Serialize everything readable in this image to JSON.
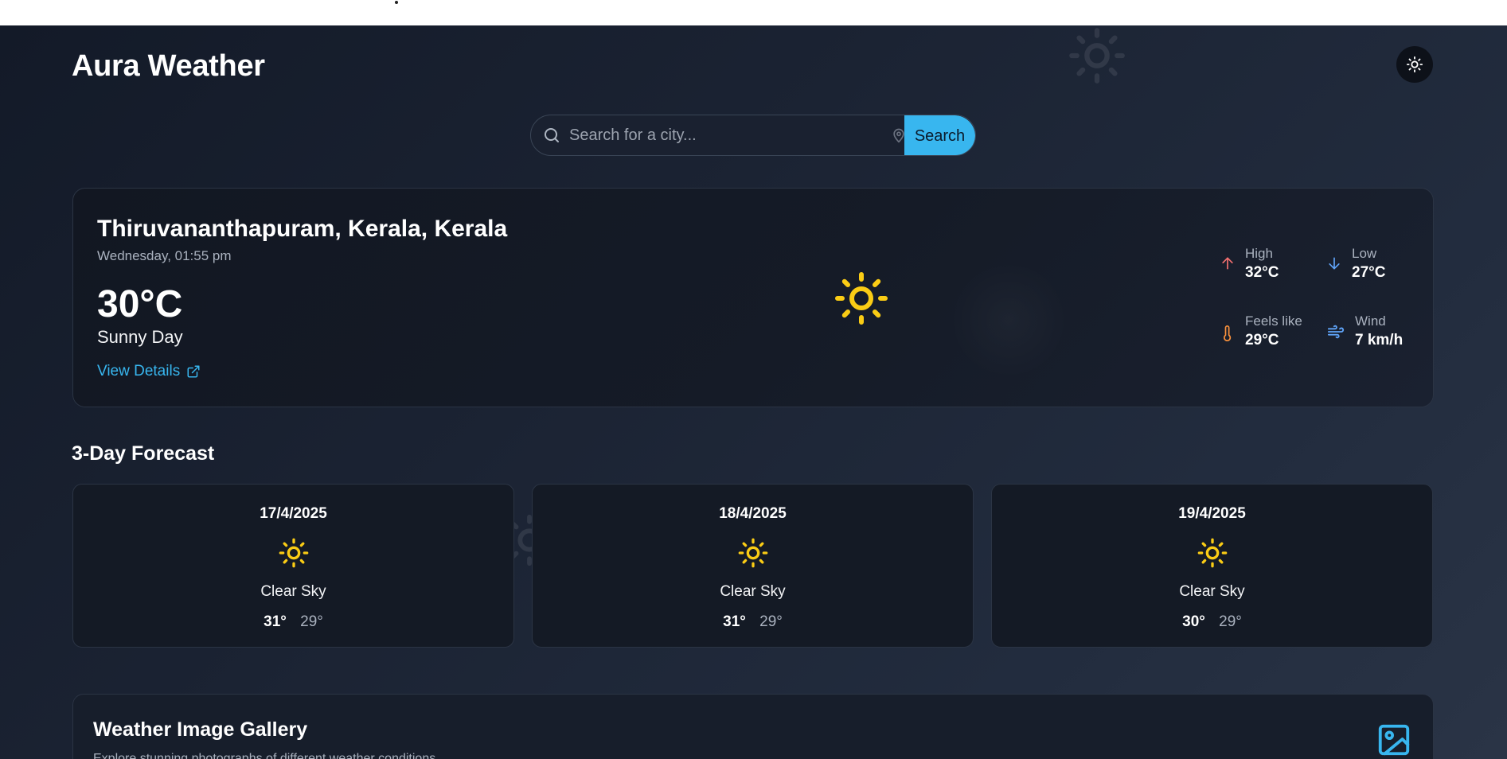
{
  "app": {
    "title": "Aura Weather"
  },
  "theme_toggle": {
    "icon": "sun-icon"
  },
  "search": {
    "placeholder": "Search for a city...",
    "button_label": "Search"
  },
  "current": {
    "location": "Thiruvananthapuram, Kerala, Kerala",
    "datetime": "Wednesday, 01:55 pm",
    "temperature": "30°C",
    "condition": "Sunny Day",
    "details_link": "View Details",
    "stats": {
      "high": {
        "label": "High",
        "value": "32°C",
        "color": "#f87171"
      },
      "low": {
        "label": "Low",
        "value": "27°C",
        "color": "#60a5fa"
      },
      "feels_like": {
        "label": "Feels like",
        "value": "29°C",
        "color": "#fb923c"
      },
      "wind": {
        "label": "Wind",
        "value": "7 km/h",
        "color": "#60a5fa"
      }
    }
  },
  "forecast": {
    "title": "3-Day Forecast",
    "days": [
      {
        "date": "17/4/2025",
        "condition": "Clear Sky",
        "high": "31°",
        "low": "29°",
        "icon": "sun-icon"
      },
      {
        "date": "18/4/2025",
        "condition": "Clear Sky",
        "high": "31°",
        "low": "29°",
        "icon": "sun-icon"
      },
      {
        "date": "19/4/2025",
        "condition": "Clear Sky",
        "high": "30°",
        "low": "29°",
        "icon": "sun-icon"
      }
    ]
  },
  "gallery": {
    "title": "Weather Image Gallery",
    "subtitle": "Explore stunning photographs of different weather conditions",
    "icon": "image-icon"
  },
  "colors": {
    "accent": "#38b6ef",
    "sun": "#facc15",
    "background": "#1b2333"
  }
}
